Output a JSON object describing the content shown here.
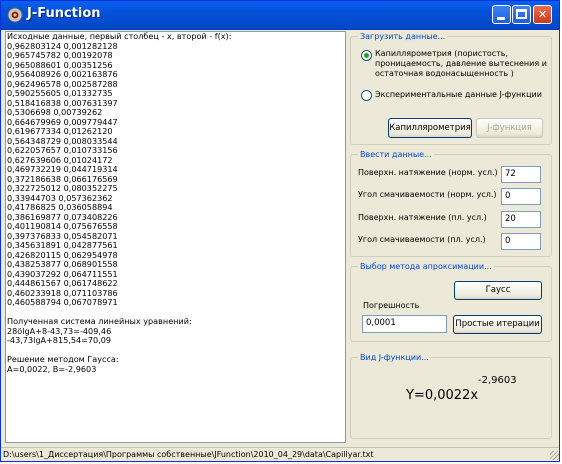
{
  "window": {
    "title": "J-Function"
  },
  "text_output": "Исходные данные, первый столбец - x, второй - f(x):\n0,962803124 0,001282128\n0,965745782 0,00192078\n0,965088601 0,00351256\n0,956408926 0,002163876\n0,962496578 0,002587288\n0,590255605 0,01332735\n0,518416838 0,007631397\n0,5306698 0,00739262\n0,664679969 0,009779447\n0,619677334 0,01262120\n0,564348729 0,008033544\n0,622057657 0,010733156\n0,627639606 0,01024172\n0,469732219 0,044719314\n0,372186638 0,066176569\n0,322725012 0,080352275\n0,33944703 0,057362362\n0,41786825 0,036058894\n0,386169877 0,073408226\n0,401190814 0,075676558\n0,397376833 0,054582071\n0,345631891 0,042877561\n0,426820115 0,062954978\n0,438253877 0,068901558\n0,439037292 0,064711551\n0,444861567 0,061748622\n0,460233918 0,071103786\n0,460588794 0,067078971\n\nПолученная система линейных уравнений:\n28ölgA+8-43,73=-409,46\n-43,73lgA+815,54=70,09\n\nРешение методом Гаусса:\nA=0,0022, B=-2,9603",
  "load_group": {
    "legend": "Загрузить данные...",
    "option1": "Капиллярометрия (пористость, проницаемость, давление вытеснения и остаточная водонасыщенность )",
    "option2": "Экспериментальные данные J-функции",
    "btn_capillary": "Капиллярометрия",
    "btn_jfunc": "J-функция"
  },
  "input_group": {
    "legend": "Ввести данные...",
    "fields": [
      {
        "label": "Поверхн. натяжение (норм. усл.)",
        "value": "72"
      },
      {
        "label": "Угол смачиваемости (норм. усл.)",
        "value": "0"
      },
      {
        "label": "Поверхн. натяжение (пл. усл.)",
        "value": "20"
      },
      {
        "label": "Угол смачиваемости (пл. усл.)",
        "value": "0"
      }
    ]
  },
  "method_group": {
    "legend": "Выбор метода апроксимации...",
    "btn_gauss": "Гаусс",
    "error_label": "Погрешность",
    "error_value": "0,0001",
    "btn_iter": "Простые итерации"
  },
  "result_group": {
    "legend": "Вид J-функции...",
    "formula_base": "Y=0,0022x",
    "formula_exp": "-2,9603"
  },
  "status_path": "D:\\users\\1_Диссертация\\Программы собственные\\JFunction\\2010_04_29\\data\\Capillyar.txt"
}
